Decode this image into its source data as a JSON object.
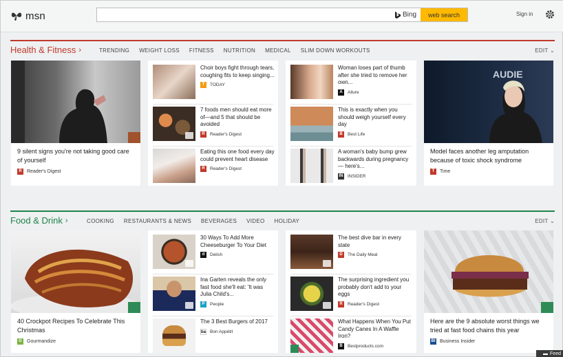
{
  "header": {
    "logo": "msn",
    "search_placeholder": "",
    "bing": "Bing",
    "web_search": "web search",
    "signin": "Sign in"
  },
  "colors": {
    "health": "#c0392b",
    "food": "#1e8449",
    "search_btn": "#ffb900"
  },
  "health": {
    "title": "Health & Fitness",
    "nav": [
      "TRENDING",
      "WEIGHT LOSS",
      "FITNESS",
      "NUTRITION",
      "MEDICAL",
      "SLIM DOWN WORKOUTS"
    ],
    "edit": "EDIT",
    "hero1": {
      "caption": "9 silent signs you're not taking good care of yourself",
      "source": "Reader's Digest"
    },
    "col2": [
      {
        "text": "Choir boys fight through tears, coughing fits to keep singing...",
        "source": "TODAY"
      },
      {
        "text": "7 foods men should eat more of—and 5 that should be avoided",
        "source": "Reader's Digest"
      },
      {
        "text": "Eating this one food every day could prevent heart disease",
        "source": "Reader's Digest"
      }
    ],
    "col3": [
      {
        "text": "Woman loses part of thumb after she tried to remove her own...",
        "source": "Allure"
      },
      {
        "text": "This is exactly when you should weigh yourself every day",
        "source": "Best Life"
      },
      {
        "text": "A woman's baby bump grew backwards during pregnancy — here's...",
        "source": "INSIDER"
      }
    ],
    "hero2": {
      "caption": "Model faces another leg amputation because of toxic shock syndrome",
      "source": "Time"
    }
  },
  "food": {
    "title": "Food & Drink",
    "nav": [
      "COOKING",
      "RESTAURANTS & NEWS",
      "BEVERAGES",
      "VIDEO",
      "HOLIDAY"
    ],
    "edit": "EDIT",
    "hero1": {
      "caption": "40 Crockpot Recipes To Celebrate This Christmas",
      "source": "Gourmandize"
    },
    "col2": [
      {
        "text": "30 Ways To Add More Cheeseburger To Your Diet",
        "source": "Delish"
      },
      {
        "text": "Ina Garten reveals the only fast food she'll eat: 'It was Julia Child's...",
        "source": "People"
      },
      {
        "text": "The 3 Best Burgers of 2017",
        "source": "Bon Appétit"
      }
    ],
    "col3": [
      {
        "text": "The best dive bar in every state",
        "source": "The Daily Meal"
      },
      {
        "text": "The surprising ingredient you probably don't add to your eggs",
        "source": "Reader's Digest"
      },
      {
        "text": "What Happens When You Put Candy Canes In A Waffle Iron?",
        "source": "Bestproducts.com"
      }
    ],
    "hero2": {
      "caption": "Here are the 9 absolute worst things we tried at fast food chains this year",
      "source": "Business Insider"
    }
  },
  "feed": "Feed"
}
